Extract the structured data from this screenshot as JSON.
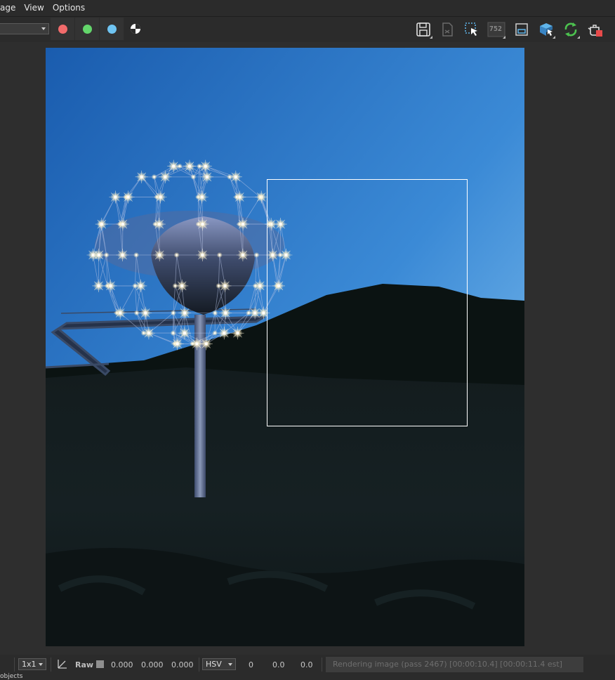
{
  "menubar": {
    "items": [
      "age",
      "View",
      "Options"
    ]
  },
  "toolbar": {
    "channels": [
      {
        "name": "red-channel",
        "color": "#f26b6b"
      },
      {
        "name": "green-channel",
        "color": "#63d66b"
      },
      {
        "name": "blue-channel",
        "color": "#6fc4f2"
      }
    ],
    "render_counter": "752"
  },
  "statusbar": {
    "zoom": "1x1",
    "raw_label": "Raw",
    "rgb": [
      "0.000",
      "0.000",
      "0.000"
    ],
    "color_mode": "HSV",
    "hsv": [
      "0",
      "0.0",
      "0.0"
    ],
    "progress_text": "Rendering image (pass 2467) [00:00:10.4] [00:00:11.4 est]"
  },
  "bottom_label": "objects",
  "colors": {
    "sky_top": "#1b5fb0",
    "sky_bottom": "#8ec8f2",
    "hill": "#0c1413",
    "ground": "#141c1e"
  }
}
